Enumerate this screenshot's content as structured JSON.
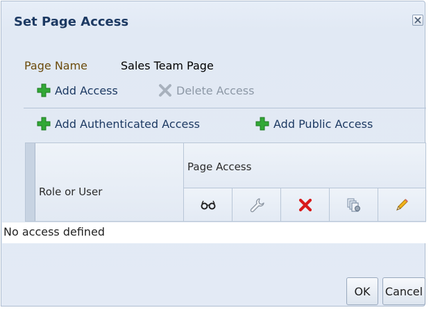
{
  "dialog": {
    "title": "Set Page Access",
    "close_icon": "close-icon"
  },
  "page": {
    "name_label": "Page Name",
    "name_value": "Sales Team Page"
  },
  "toolbar": {
    "add_access": "Add Access",
    "delete_access": "Delete Access",
    "add_authenticated_access": "Add Authenticated Access",
    "add_public_access": "Add Public Access"
  },
  "table": {
    "col_role": "Role or User",
    "col_group": "Page Access",
    "icon_columns": [
      "view-icon",
      "customize-icon",
      "delete-icon",
      "manage-icon",
      "edit-icon"
    ],
    "empty_text": "No access defined"
  },
  "buttons": {
    "ok": "OK",
    "cancel": "Cancel"
  },
  "colors": {
    "title": "#1d3a63",
    "label": "#6b4a0a",
    "add_green": "#2fa52f",
    "delete_red": "#d81b1b"
  }
}
